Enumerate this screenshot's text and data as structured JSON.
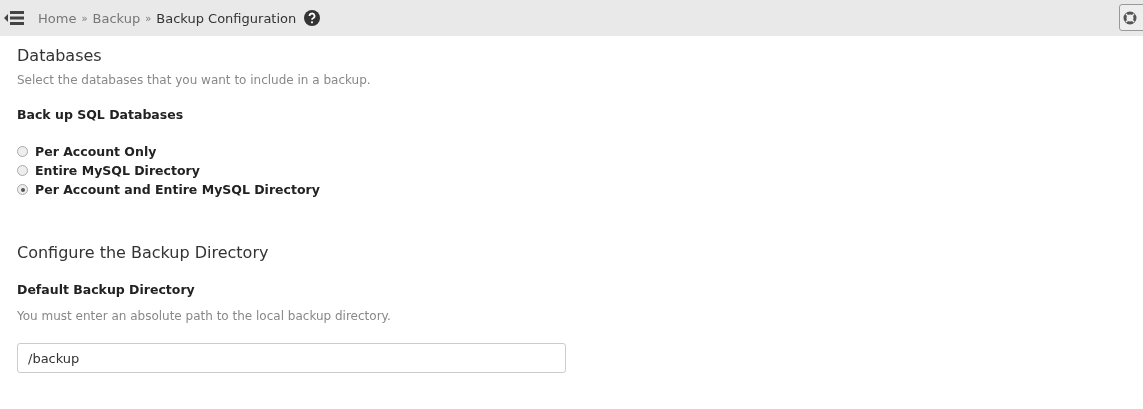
{
  "breadcrumb": [
    {
      "label": "Home",
      "kind": "link"
    },
    {
      "label": "»",
      "kind": "separator"
    },
    {
      "label": "Backup",
      "kind": "link"
    },
    {
      "label": "»",
      "kind": "separator"
    },
    {
      "label": "Backup Configuration",
      "kind": "current"
    }
  ],
  "databases": {
    "title": "Databases",
    "description": "Select the databases that you want to include in a backup.",
    "label": "Back up SQL Databases",
    "options": [
      {
        "label": "Per Account Only",
        "selected": false
      },
      {
        "label": "Entire MySQL Directory",
        "selected": false
      },
      {
        "label": "Per Account and Entire MySQL Directory",
        "selected": true
      }
    ]
  },
  "directory": {
    "title": "Configure the Backup Directory",
    "label": "Default Backup Directory",
    "description": "You must enter an absolute path to the local backup directory.",
    "value": "/backup"
  }
}
